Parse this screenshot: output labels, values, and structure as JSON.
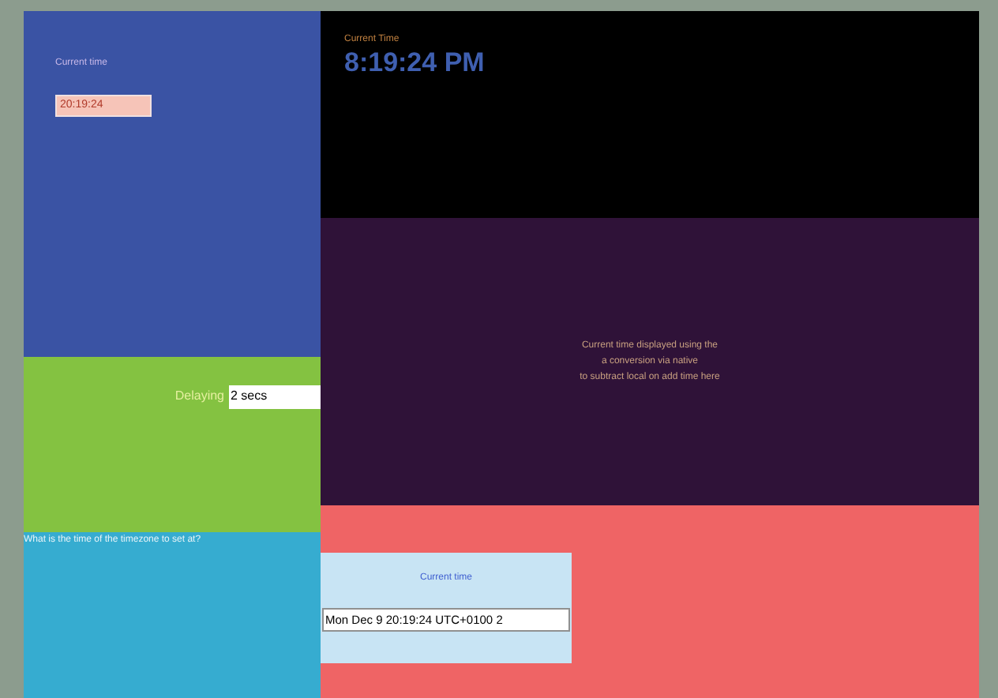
{
  "clock_panel": {
    "label": "Current time",
    "value": "20:19:24"
  },
  "big_clock": {
    "label": "Current Time",
    "time": "8:19:24 PM"
  },
  "message": {
    "lines": [
      "Current time displayed using the",
      "a conversion via native",
      "to subtract local on add time here"
    ]
  },
  "delay": {
    "label": "Delaying",
    "value": "2 secs"
  },
  "question": {
    "text": "What is the time of the timezone to set at?"
  },
  "date_box": {
    "label": "Current time",
    "value": "Mon Dec 9 20:19:24 UTC+0100 2"
  }
}
